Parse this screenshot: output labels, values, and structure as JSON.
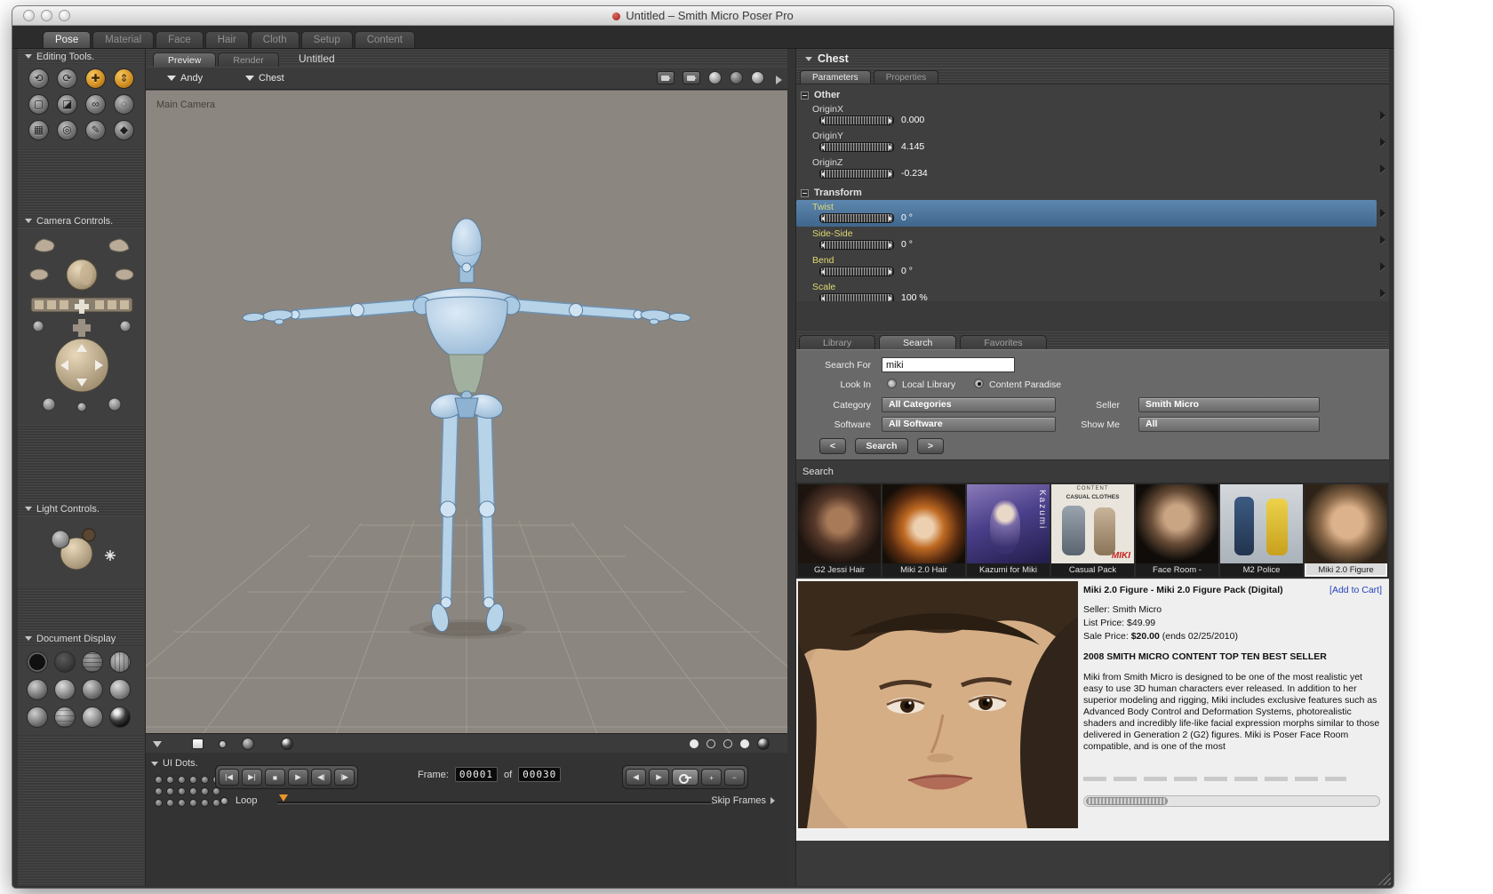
{
  "titlebar": {
    "title": "Untitled – Smith Micro Poser Pro"
  },
  "main_tabs": [
    {
      "label": "Pose"
    },
    {
      "label": "Material"
    },
    {
      "label": "Face"
    },
    {
      "label": "Hair"
    },
    {
      "label": "Cloth"
    },
    {
      "label": "Setup"
    },
    {
      "label": "Content"
    }
  ],
  "sidebar": {
    "editing_tools_title": "Editing Tools.",
    "camera_controls_title": "Camera Controls.",
    "light_controls_title": "Light Controls.",
    "document_display_title": "Document Display",
    "tools": [
      {
        "name": "rotate-tool",
        "glyph": "⟲"
      },
      {
        "name": "twist-tool",
        "glyph": "⟳"
      },
      {
        "name": "translate-pull-tool",
        "glyph": "✚"
      },
      {
        "name": "translate-in-out-tool",
        "glyph": "⇕"
      },
      {
        "name": "scale-tool",
        "glyph": "▢"
      },
      {
        "name": "taper-tool",
        "glyph": "◪"
      },
      {
        "name": "chain-break-tool",
        "glyph": "∞"
      },
      {
        "name": "color-tool",
        "glyph": "◌"
      },
      {
        "name": "grouping-tool",
        "glyph": "▦"
      },
      {
        "name": "view-magnifier-tool",
        "glyph": "◎"
      },
      {
        "name": "morphing-tool",
        "glyph": "✎"
      },
      {
        "name": "direct-manipulation-tool",
        "glyph": "◆"
      }
    ]
  },
  "document": {
    "tabs": [
      {
        "label": "Preview"
      },
      {
        "label": "Render"
      }
    ],
    "title": "Untitled",
    "figure_menu": "Andy",
    "actor_menu": "Chest",
    "camera_label": "Main Camera"
  },
  "timeline": {
    "ui_dots_label": "UI Dots.",
    "transport_left": [
      "|◀",
      "▶|",
      "■",
      "▶",
      "◀|",
      "|▶"
    ],
    "frame_label": "Frame:",
    "frame_current": "00001",
    "of_label": "of",
    "frame_total": "00030",
    "prev": "◀",
    "next": "▶",
    "plus": "+",
    "minus": "−",
    "loop_label": "Loop",
    "skip_frames_label": "Skip Frames"
  },
  "parameters": {
    "actor": "Chest",
    "tabs": [
      {
        "label": "Parameters"
      },
      {
        "label": "Properties"
      }
    ],
    "group_other": "Other",
    "group_transform": "Transform",
    "rows": [
      {
        "name": "OriginX",
        "value": "0.000"
      },
      {
        "name": "OriginY",
        "value": "4.145"
      },
      {
        "name": "OriginZ",
        "value": "-0.234"
      },
      {
        "name": "Twist",
        "value": "0 °"
      },
      {
        "name": "Side-Side",
        "value": "0 °"
      },
      {
        "name": "Bend",
        "value": "0 °"
      },
      {
        "name": "Scale",
        "value": "100 %"
      }
    ]
  },
  "library": {
    "tabs": [
      {
        "label": "Library"
      },
      {
        "label": "Search"
      },
      {
        "label": "Favorites"
      }
    ],
    "search_for_label": "Search For",
    "search_value": "miki",
    "look_in_label": "Look In",
    "local_library_label": "Local Library",
    "content_paradise_label": "Content Paradise",
    "category_label": "Category",
    "category_value": "All Categories",
    "seller_label": "Seller",
    "seller_value": "Smith Micro",
    "software_label": "Software",
    "software_value": "All Software",
    "show_me_label": "Show Me",
    "show_me_value": "All",
    "prev_label": "<",
    "search_label": "Search",
    "next_label": ">",
    "results_header": "Search"
  },
  "results": [
    {
      "label": "G2 Jessi Hair"
    },
    {
      "label": "Miki 2.0 Hair"
    },
    {
      "label": "Kazumi for Miki",
      "overlay": "Kazumi"
    },
    {
      "label": "Casual Pack",
      "overlay_top": "CONTENT",
      "overlay_mid": "CASUAL CLOTHES",
      "overlay_brand": "MIKI"
    },
    {
      "label": "Face Room -"
    },
    {
      "label": "M2 Police"
    },
    {
      "label": "Miki 2.0 Figure"
    }
  ],
  "product": {
    "title": "Miki 2.0 Figure - Miki 2.0 Figure Pack (Digital)",
    "add_to_cart": "[Add to Cart]",
    "seller": "Seller: Smith Micro",
    "list_price": "List Price: $49.99",
    "sale_price_prefix": "Sale Price: ",
    "sale_price_value": "$20.00",
    "sale_price_suffix": " (ends 02/25/2010)",
    "banner": "2008 SMITH MICRO CONTENT TOP TEN BEST SELLER",
    "description": "Miki from Smith Micro is designed to be one of the most realistic yet easy to use 3D human characters ever released. In addition to her superior modeling and rigging, Miki includes exclusive features such as Advanced Body Control and Deformation Systems, photorealistic shaders and incredibly life-like facial expression morphs similar to those delivered in Generation 2 (G2) figures. Miki is Poser Face Room compatible, and is one of the most"
  }
}
